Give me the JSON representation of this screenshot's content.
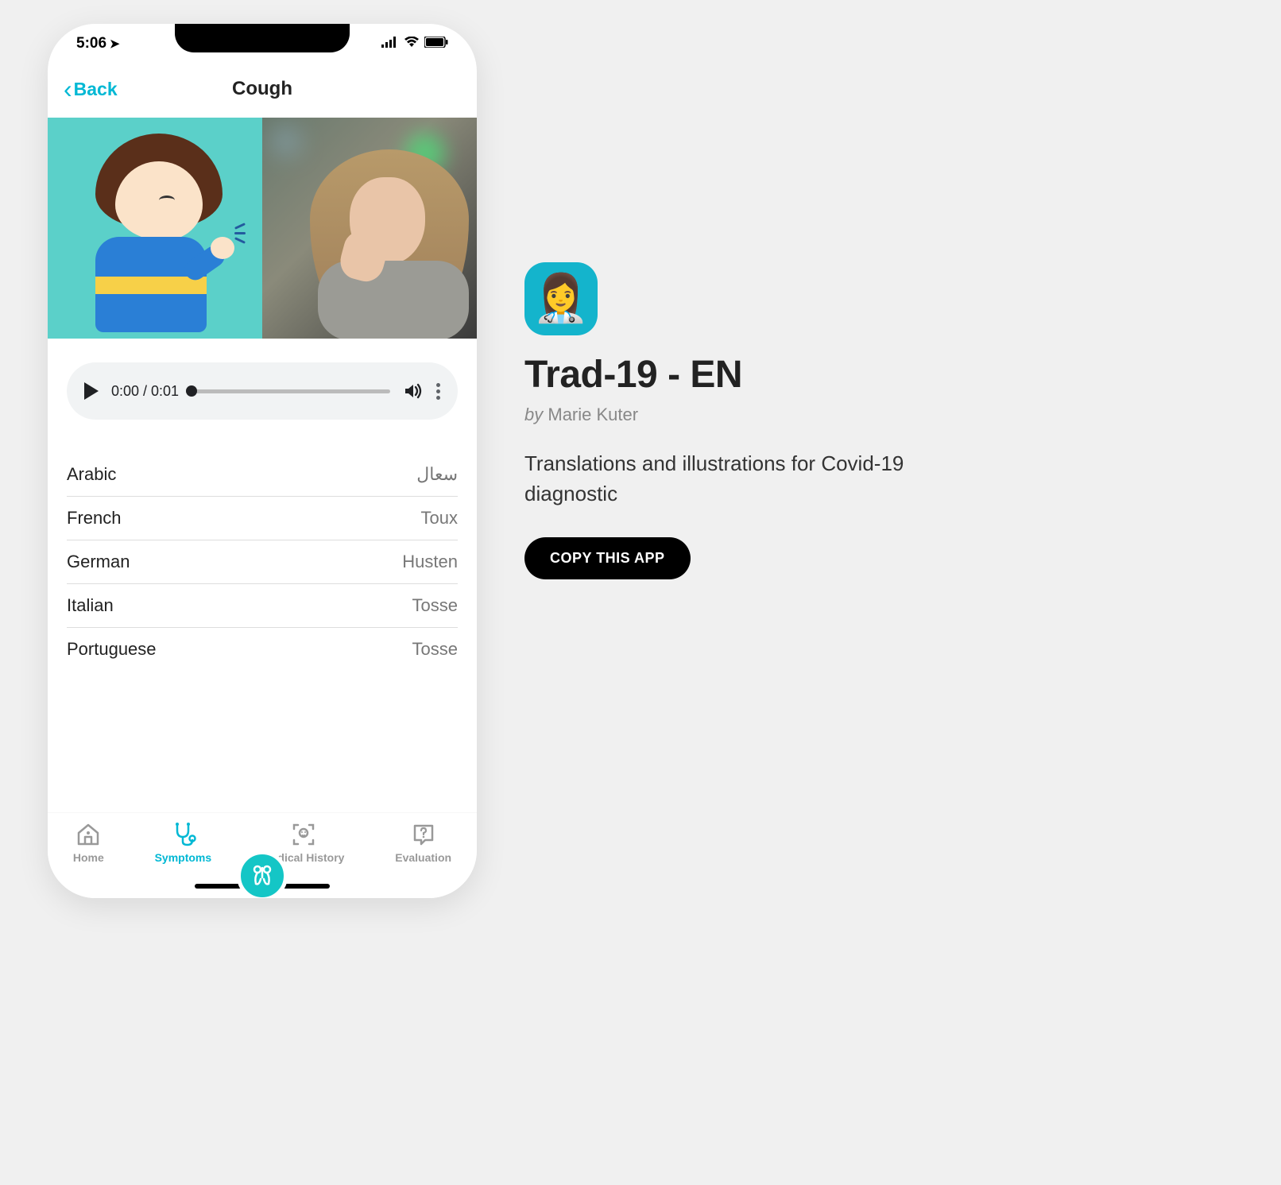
{
  "statusbar": {
    "time": "5:06"
  },
  "nav": {
    "back_label": "Back",
    "title": "Cough"
  },
  "audio": {
    "time_display": "0:00 / 0:01"
  },
  "translations": [
    {
      "lang": "Arabic",
      "value": "سعال"
    },
    {
      "lang": "French",
      "value": "Toux"
    },
    {
      "lang": "German",
      "value": "Husten"
    },
    {
      "lang": "Italian",
      "value": "Tosse"
    },
    {
      "lang": "Portuguese",
      "value": "Tosse"
    }
  ],
  "tabs": {
    "home": "Home",
    "symptoms": "Symptoms",
    "history": "Medical History",
    "evaluation": "Evaluation"
  },
  "info": {
    "app_icon_emoji": "👩‍⚕️",
    "title": "Trad-19 - EN",
    "by": "by",
    "author": "Marie Kuter",
    "description": "Translations and illustrations for Covid-19 diagnostic",
    "copy_label": "COPY THIS APP"
  }
}
